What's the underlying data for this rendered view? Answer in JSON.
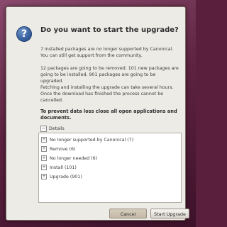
{
  "dialog": {
    "title": "Do you want to start the upgrade?",
    "icon": "question-icon",
    "icon_glyph": "?",
    "paragraphs": [
      "7 installed packages are no longer supported by Canonical. You can still get support from the community.",
      "12 packages are going to be removed. 101 new packages are going to be installed. 901 packages are going to be upgraded.",
      "Fetching and installing the upgrade can take several hours. Once the download has finished the process cannot be cancelled."
    ],
    "warning": "To prevent data loss close all open applications and documents."
  },
  "details": {
    "label": "Details",
    "expander_glyph": "−",
    "items": [
      {
        "label": "No longer supported by Canonical (7)",
        "glyph": "+"
      },
      {
        "label": "Remove (6)",
        "glyph": "+"
      },
      {
        "label": "No longer needed (6)",
        "glyph": "+"
      },
      {
        "label": "Install (101)",
        "glyph": "+"
      },
      {
        "label": "Upgrade (901)",
        "glyph": "+"
      }
    ]
  },
  "buttons": {
    "cancel": "Cancel",
    "start": "Start Upgrade"
  },
  "colors": {
    "dialog_bg": "#edebe6",
    "accent": "#3b65a3",
    "desktop": "#5e2341"
  }
}
